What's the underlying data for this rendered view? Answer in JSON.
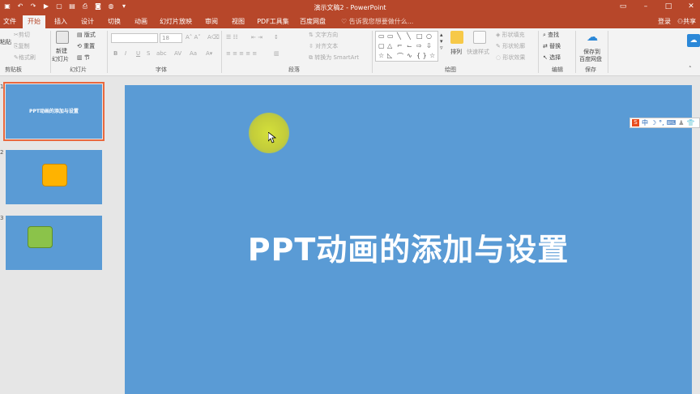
{
  "window": {
    "title": "演示文稿2 - PowerPoint",
    "qat_icons": [
      "powerpoint-logo-icon",
      "save-icon",
      "undo-icon",
      "redo-icon",
      "present-icon",
      "new-icon",
      "open-icon",
      "print-icon",
      "camera-icon",
      "misc-icon",
      "more-icon"
    ],
    "controls": [
      "restore-ribbon-icon",
      "minimize-icon",
      "maximize-icon",
      "close-icon"
    ]
  },
  "tabs": [
    {
      "label": "文件"
    },
    {
      "label": "开始"
    },
    {
      "label": "插入"
    },
    {
      "label": "设计"
    },
    {
      "label": "切换"
    },
    {
      "label": "动画"
    },
    {
      "label": "幻灯片放映"
    },
    {
      "label": "审阅"
    },
    {
      "label": "视图"
    },
    {
      "label": "PDF工具集"
    },
    {
      "label": "百度网盘"
    }
  ],
  "tell_me": "告诉我您想要做什么...",
  "account": {
    "login": "登录",
    "share": "共享"
  },
  "ribbon": {
    "clipboard": {
      "paste": "粘贴",
      "cut": "剪切",
      "copy": "复制",
      "format_painter": "格式刷",
      "label": "剪贴板"
    },
    "slides": {
      "new_slide": "新建",
      "new_slide_2": "幻灯片",
      "layout": "版式",
      "reset": "重置",
      "section": "节",
      "label": "幻灯片"
    },
    "font": {
      "size": "18",
      "label": "字体",
      "bold": "B",
      "italic": "I",
      "underline": "U",
      "strike": "S",
      "spacing": "abc",
      "case": "Aa"
    },
    "paragraph": {
      "text_direction": "文字方向",
      "align_text": "对齐文本",
      "smartart": "转换为 SmartArt",
      "label": "段落"
    },
    "drawing": {
      "arrange": "排列",
      "quick_styles": "快速样式",
      "shape_fill": "形状填充",
      "shape_outline": "形状轮廓",
      "shape_effect": "形状效果",
      "label": "绘图"
    },
    "editing": {
      "find": "查找",
      "replace": "替换",
      "select": "选择",
      "label": "编辑"
    },
    "save": {
      "save_to": "保存到",
      "baidu": "百度网盘",
      "label": "保存"
    }
  },
  "slides": [
    {
      "num": "1",
      "title": "PPT动画的添加与设置"
    },
    {
      "num": "2",
      "title": ""
    },
    {
      "num": "3",
      "title": ""
    }
  ],
  "current_slide": {
    "title": "PPT动画的添加与设置"
  },
  "ime_toolbar": {
    "items": [
      "S",
      "中",
      "☽",
      "°,",
      "⌨",
      "♟",
      "👕"
    ]
  },
  "colors": {
    "accent": "#b7472a",
    "slide_bg": "#5a9bd5",
    "selection": "#e9693f",
    "shape_orange": "#ffb300",
    "shape_green": "#8bc34a"
  }
}
